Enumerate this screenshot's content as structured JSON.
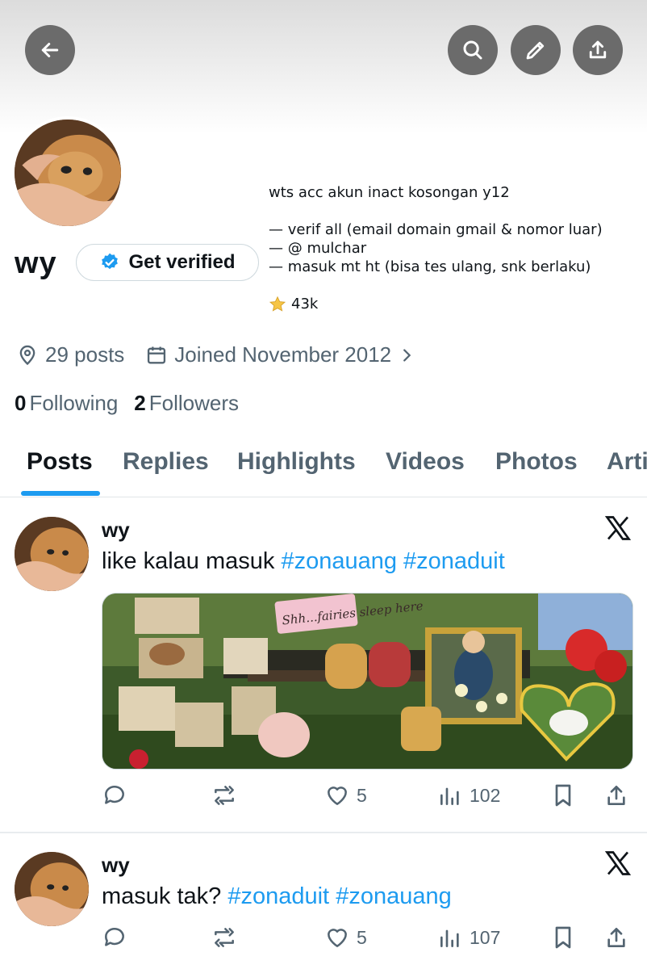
{
  "profile": {
    "name": "wy",
    "verify_label": "Get verified",
    "bio_lines": [
      "wts acc akun inact kosongan y12",
      "",
      "— verif all (email domain gmail & nomor luar)",
      "— @ mulchar",
      "— masuk mt ht (bisa tes ulang, snk berlaku)",
      "",
      "43k"
    ],
    "location": "29 posts",
    "joined": "Joined November 2012",
    "following_count": "0",
    "following_label": "Following",
    "followers_count": "2",
    "followers_label": "Followers"
  },
  "tabs": [
    "Posts",
    "Replies",
    "Highlights",
    "Videos",
    "Photos",
    "Arti"
  ],
  "posts": [
    {
      "author": "wy",
      "text": "like kalau masuk ",
      "hashtags": [
        "#zonauang",
        "#zonaduit"
      ],
      "media_caption": "Shh...fairies sleep here",
      "likes": "5",
      "views": "102"
    },
    {
      "author": "wy",
      "text": "masuk tak? ",
      "hashtags": [
        "#zonaduit",
        "#zonauang"
      ],
      "likes": "5",
      "views": "107"
    }
  ],
  "colors": {
    "accent": "#1d9bf0",
    "secondary_text": "#536471",
    "header_button": "#6b6b6b"
  }
}
